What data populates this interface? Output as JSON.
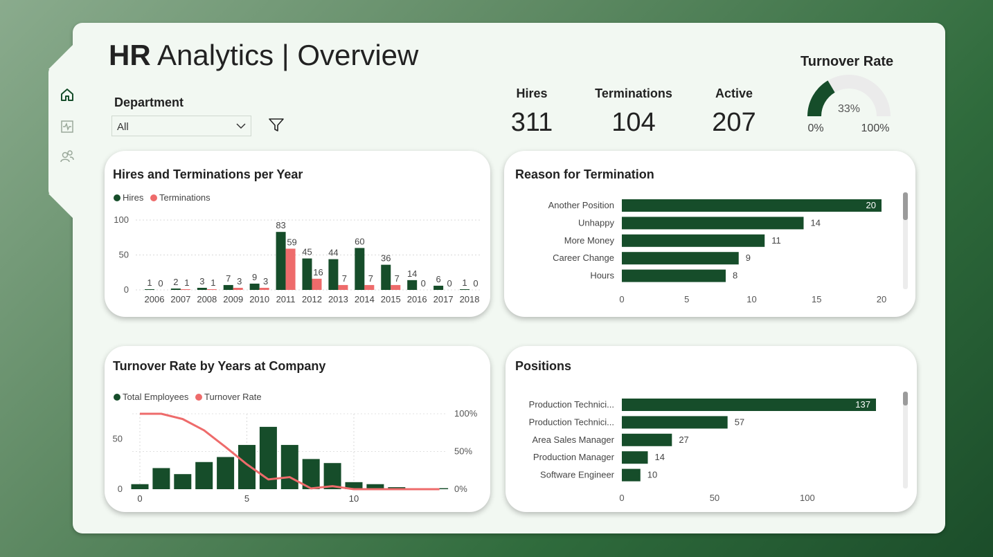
{
  "header": {
    "title_bold": "HR",
    "title_rest": " Analytics | Overview"
  },
  "nav": {
    "icons": [
      "home-icon",
      "pulse-icon",
      "people-icon"
    ]
  },
  "filter": {
    "label": "Department",
    "value": "All"
  },
  "kpis": [
    {
      "label": "Hires",
      "value": "311"
    },
    {
      "label": "Terminations",
      "value": "104"
    },
    {
      "label": "Active",
      "value": "207"
    }
  ],
  "turnover": {
    "title": "Turnover Rate",
    "value": 0.33,
    "value_label": "33%",
    "min_label": "0%",
    "max_label": "100%"
  },
  "colors": {
    "accent": "#164d2a",
    "secondary": "#ee6b6b",
    "panel": "#f2f8f2"
  },
  "chart_data": [
    {
      "type": "bar",
      "title": "Hires and Terminations per Year",
      "categories": [
        "2006",
        "2007",
        "2008",
        "2009",
        "2010",
        "2011",
        "2012",
        "2013",
        "2014",
        "2015",
        "2016",
        "2017",
        "2018"
      ],
      "series": [
        {
          "name": "Hires",
          "values": [
            1,
            2,
            3,
            7,
            9,
            83,
            45,
            44,
            60,
            36,
            14,
            6,
            1
          ]
        },
        {
          "name": "Terminations",
          "values": [
            0,
            1,
            1,
            3,
            3,
            59,
            16,
            7,
            7,
            7,
            0,
            0,
            0
          ]
        }
      ],
      "ylim": [
        0,
        100
      ],
      "yticks": [
        "0",
        "50",
        "100"
      ],
      "legend": "top-left",
      "grid": true
    },
    {
      "type": "bar",
      "orientation": "horizontal",
      "title": "Reason for Termination",
      "categories": [
        "Another Position",
        "Unhappy",
        "More Money",
        "Career Change",
        "Hours"
      ],
      "values": [
        20,
        14,
        11,
        9,
        8
      ],
      "xlim": [
        0,
        20
      ],
      "xticks": [
        "0",
        "5",
        "10",
        "15",
        "20"
      ]
    },
    {
      "type": "bar",
      "title": "Turnover Rate by Years at Company",
      "x": [
        0,
        1,
        2,
        3,
        4,
        5,
        6,
        7,
        8,
        9,
        10,
        11,
        12,
        13,
        14
      ],
      "series": [
        {
          "name": "Total Employees",
          "type": "bar",
          "values": [
            5,
            21,
            15,
            27,
            32,
            44,
            62,
            44,
            30,
            26,
            7,
            5,
            2,
            1,
            1
          ]
        },
        {
          "name": "Turnover Rate",
          "type": "line",
          "axis": "right",
          "values": [
            1.0,
            1.0,
            0.93,
            0.78,
            0.56,
            0.33,
            0.13,
            0.16,
            0.01,
            0.04,
            0.0,
            0.0,
            0.0,
            0.0,
            0.0
          ]
        }
      ],
      "ylim": [
        0,
        75
      ],
      "yticks_left": [
        "0",
        "50"
      ],
      "yticks_right": [
        "0%",
        "50%",
        "100%"
      ],
      "xticks": [
        "0",
        "5",
        "10"
      ],
      "legend": "top-left"
    },
    {
      "type": "bar",
      "orientation": "horizontal",
      "title": "Positions",
      "categories": [
        "Production Technici...",
        "Production Technici...",
        "Area Sales Manager",
        "Production Manager",
        "Software Engineer"
      ],
      "values": [
        137,
        57,
        27,
        14,
        10
      ],
      "xlim": [
        0,
        137
      ],
      "xticks": [
        "0",
        "50",
        "100"
      ]
    }
  ]
}
